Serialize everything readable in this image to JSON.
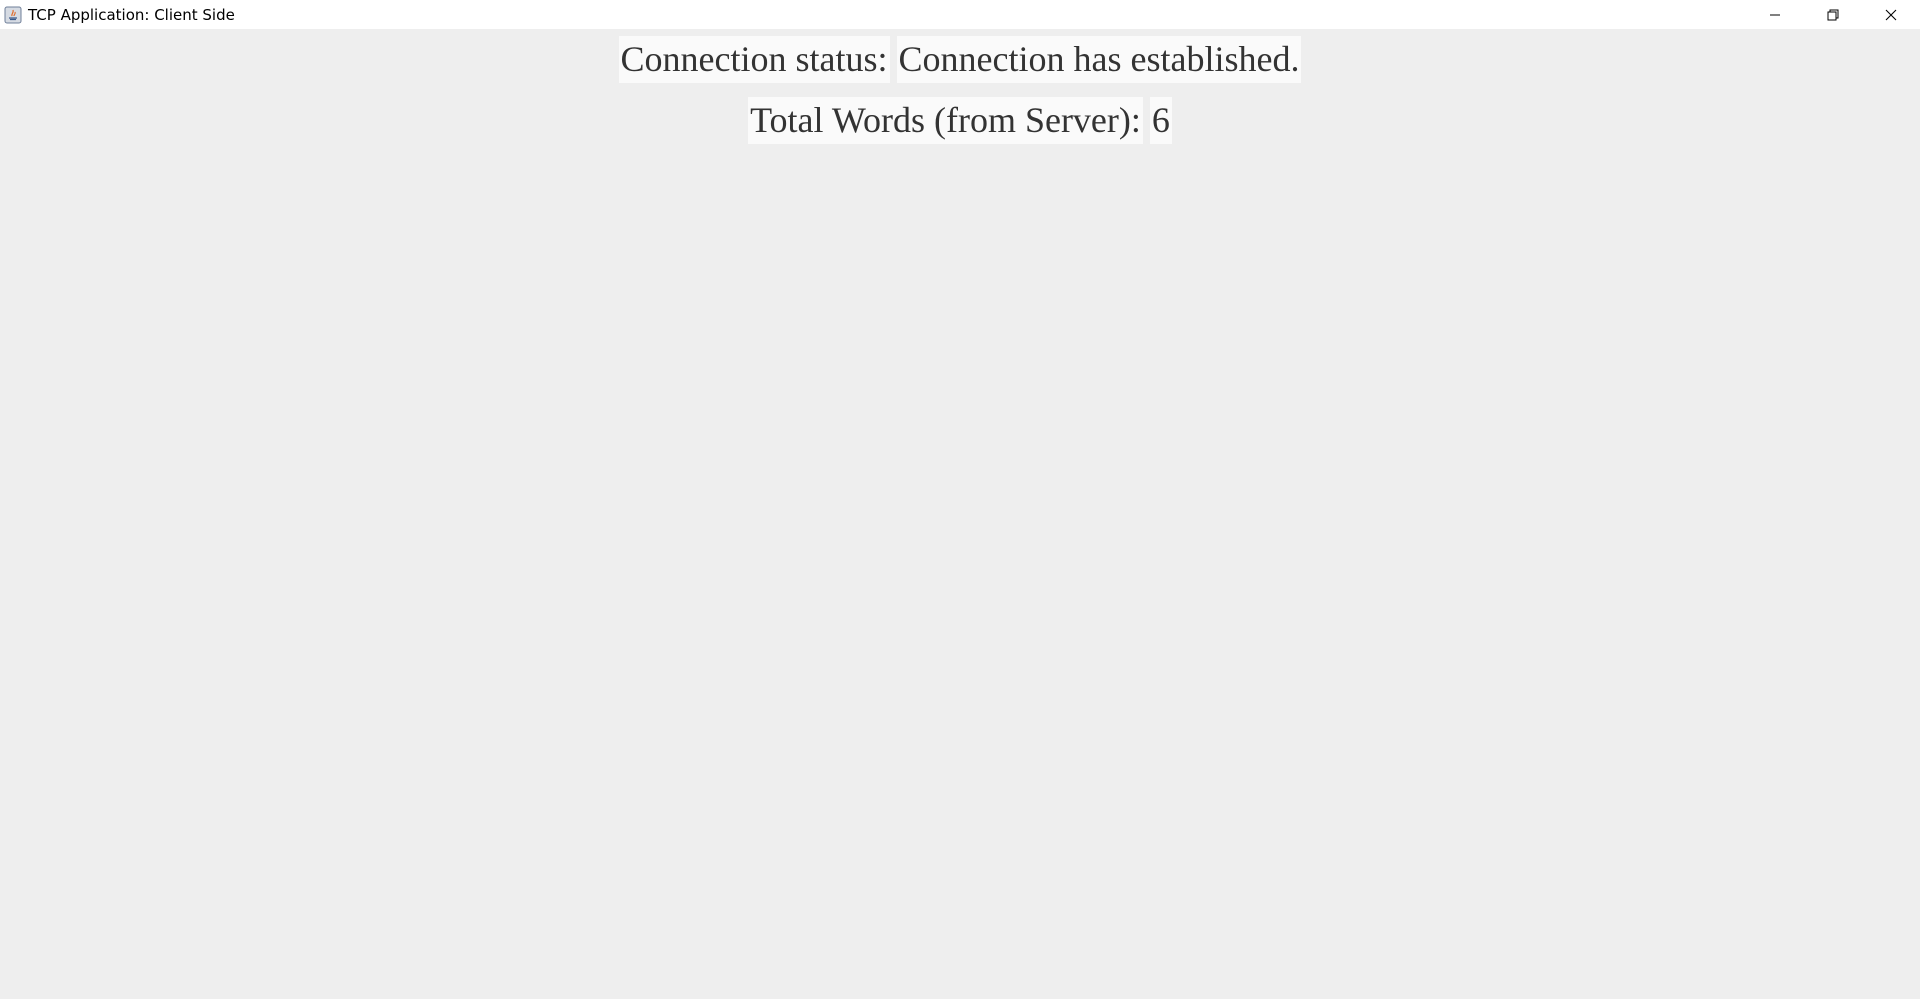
{
  "window": {
    "title": "TCP Application: Client Side",
    "app_icon": "java-icon",
    "controls": [
      "minimize-icon",
      "restore-icon",
      "close-icon"
    ]
  },
  "connection": {
    "label": "Connection status:",
    "value": "Connection has established."
  },
  "words": {
    "label": "Total Words (from Server):",
    "value": "6"
  },
  "colors": {
    "background": "#eeeeee",
    "label_background": "#fafafa",
    "text": "#333333"
  }
}
